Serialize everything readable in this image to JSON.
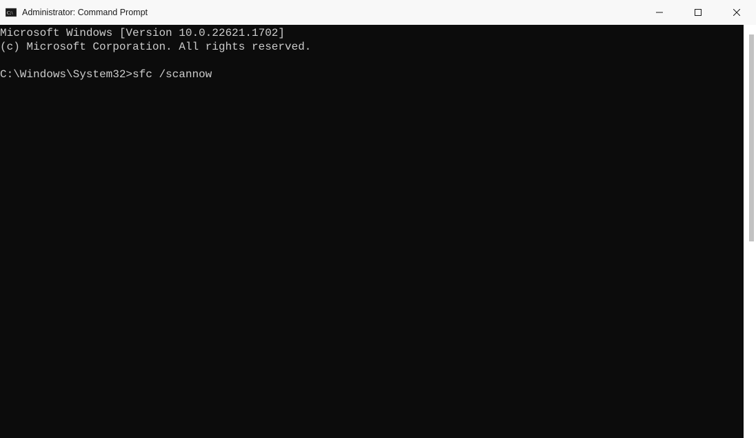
{
  "window": {
    "title": "Administrator: Command Prompt"
  },
  "terminal": {
    "line1": "Microsoft Windows [Version 10.0.22621.1702]",
    "line2": "(c) Microsoft Corporation. All rights reserved.",
    "blank": "",
    "prompt": "C:\\Windows\\System32>",
    "command": "sfc /scannow"
  }
}
